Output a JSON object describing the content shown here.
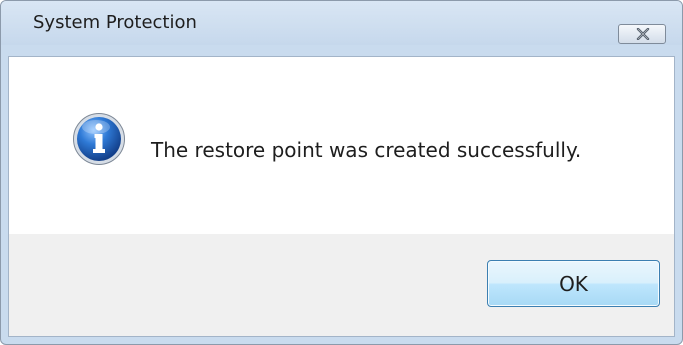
{
  "window": {
    "title": "System Protection",
    "close_icon": "close-icon"
  },
  "message": {
    "icon": "info-icon",
    "text": "The restore point was created successfully."
  },
  "buttons": {
    "ok_label": "OK"
  },
  "colors": {
    "titlebar": "#c6d8ec",
    "footer": "#f0f0f0",
    "ok_border": "#3c7fb1",
    "info_blue": "#1f5fb3"
  }
}
